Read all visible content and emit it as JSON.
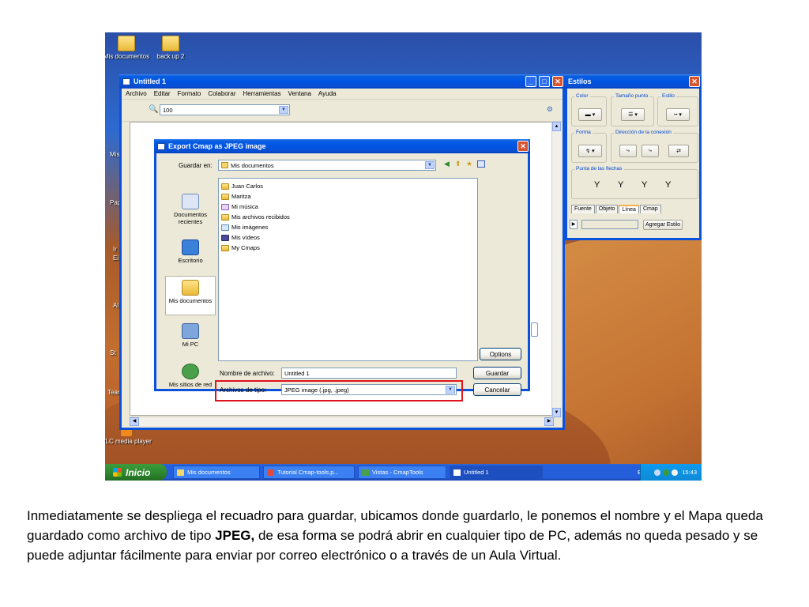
{
  "desktop": {
    "icons": [
      {
        "label": "Mis documentos"
      },
      {
        "label": "back up 2"
      },
      {
        "label": "VLC media player"
      }
    ],
    "edge_fragments": [
      "Mis",
      "Pap",
      "Ir",
      "Ei",
      "Al",
      "St",
      "Tear"
    ]
  },
  "cmap_window": {
    "title": "Untitled 1",
    "menu": [
      "Archivo",
      "Editar",
      "Formato",
      "Colaborar",
      "Herramientas",
      "Ventana",
      "Ayuda"
    ],
    "zoom_value": "100"
  },
  "export_dialog": {
    "title": "Export Cmap as JPEG image",
    "save_in_label": "Guardar en:",
    "save_in_value": "Mis documentos",
    "places": [
      {
        "label": "Documentos recientes"
      },
      {
        "label": "Escritorio"
      },
      {
        "label": "Mis documentos"
      },
      {
        "label": "Mi PC"
      },
      {
        "label": "Mis sitios de red"
      }
    ],
    "files": [
      {
        "name": "Juan Carlos"
      },
      {
        "name": "Maritza"
      },
      {
        "name": "Mi música"
      },
      {
        "name": "Mis archivos recibidos"
      },
      {
        "name": "Mis imágenes"
      },
      {
        "name": "Mis vídeos"
      },
      {
        "name": "My Cmaps"
      }
    ],
    "filename_label": "Nombre de archivo:",
    "filename_value": "Untitled 1",
    "filetype_label": "Archivos de tipo:",
    "filetype_value": "JPEG image (.jpg, .jpeg)",
    "options_button": "Options",
    "save_button": "Guardar",
    "cancel_button": "Cancelar"
  },
  "estilos": {
    "title": "Estilos",
    "group_color": "Color",
    "group_tamano": "Tamaño punto",
    "group_estilo": "Estilo",
    "group_forma": "Forma",
    "group_direccion": "Dirección de la conexión",
    "group_punta": "Punta de las flechas",
    "tabs": [
      "Fuente",
      "Objeto",
      "Línea",
      "Cmap"
    ],
    "active_tab": "Línea",
    "add_style_button": "Agregar Estilo"
  },
  "taskbar": {
    "start_label": "Inicio",
    "tasks": [
      {
        "label": "Mis documentos"
      },
      {
        "label": "Tutorial Cmap-tools.p..."
      },
      {
        "label": "Vistas - CmapTools"
      },
      {
        "label": "Untitled 1"
      }
    ],
    "language": "ES",
    "clock": "15:43"
  },
  "caption": {
    "part1": "Inmediatamente se despliega el recuadro para guardar, ubicamos donde guardarlo, le ponemos el nombre y el Mapa queda guardado como archivo de tipo ",
    "bold": "JPEG,",
    "part2": " de esa forma se podrá abrir en cualquier tipo de PC, además no queda pesado y se puede adjuntar fácilmente para enviar por correo electrónico o a través de un Aula Virtual."
  },
  "colors": {
    "highlight_box": "#e0141e",
    "xp_blue": "#0054e3",
    "window_face": "#ece9d8"
  }
}
